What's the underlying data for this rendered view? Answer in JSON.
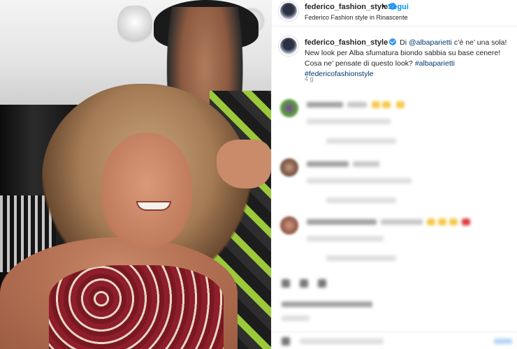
{
  "post": {
    "username": "federico_fashion_style",
    "follow_label": "Segui",
    "separator": "•",
    "location": "Federico Fashion style in Rinascente"
  },
  "caption": {
    "username": "federico_fashion_style",
    "text_part1": " Di ",
    "mention": "@albaparietti",
    "text_part2": " c’è ne’ una sola! New look per Alba sfumatura biondo sabbia su base cenere! Cosa ne’ pensate di questo look? ",
    "hashtags": "#albaparietti #federicofashionstyle",
    "time": "4 g"
  },
  "colors": {
    "link": "#00376b",
    "follow": "#0095f6",
    "verified": "#3897f0"
  },
  "icons": [
    "verified-icon",
    "heart-icon",
    "comment-icon",
    "share-icon",
    "bookmark-icon",
    "emoji-icon"
  ]
}
